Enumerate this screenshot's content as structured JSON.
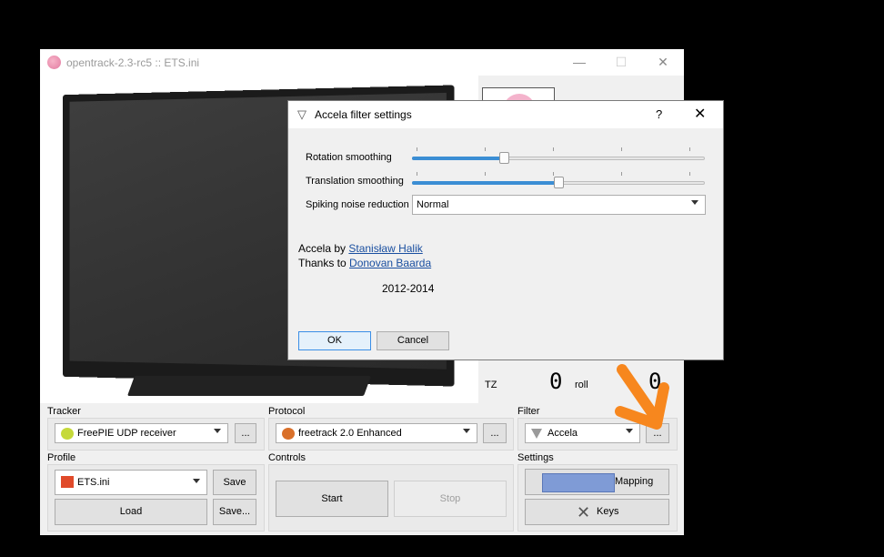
{
  "window": {
    "title": "opentrack-2.3-rc5 :: ETS.ini",
    "minimize_icon": "—",
    "maximize_icon": "☐",
    "close_icon": "✕"
  },
  "pose": {
    "tz_label": "TZ",
    "tz_value": "0",
    "roll_label": "roll",
    "roll_value": "0"
  },
  "tracker": {
    "label": "Tracker",
    "selected": "FreePIE UDP receiver",
    "options_label": "..."
  },
  "protocol": {
    "label": "Protocol",
    "selected": "freetrack 2.0 Enhanced",
    "options_label": "..."
  },
  "filter": {
    "label": "Filter",
    "selected": "Accela",
    "options_label": "..."
  },
  "profile": {
    "label": "Profile",
    "selected": "ETS.ini",
    "save_label": "Save",
    "load_label": "Load",
    "save_as_label": "Save..."
  },
  "controls": {
    "label": "Controls",
    "start_label": "Start",
    "stop_label": "Stop"
  },
  "settings": {
    "label": "Settings",
    "mapping_label": "Mapping",
    "keys_label": "Keys"
  },
  "dialog": {
    "title": "Accela filter settings",
    "help_icon": "?",
    "close_icon": "✕",
    "rotation_label": "Rotation smoothing",
    "rotation_value": 0.31,
    "translation_label": "Translation smoothing",
    "translation_value": 0.5,
    "spiking_label": "Spiking noise reduction",
    "spiking_value": "Normal",
    "credit_prefix": "Accela by",
    "credit_author": "Stanisław Halik",
    "thanks_prefix": "Thanks to",
    "thanks_name": "Donovan Baarda",
    "years": "2012-2014",
    "ok_label": "OK",
    "cancel_label": "Cancel"
  },
  "annotation_color": "#f7871e",
  "accent_color": "#3b8ed4"
}
